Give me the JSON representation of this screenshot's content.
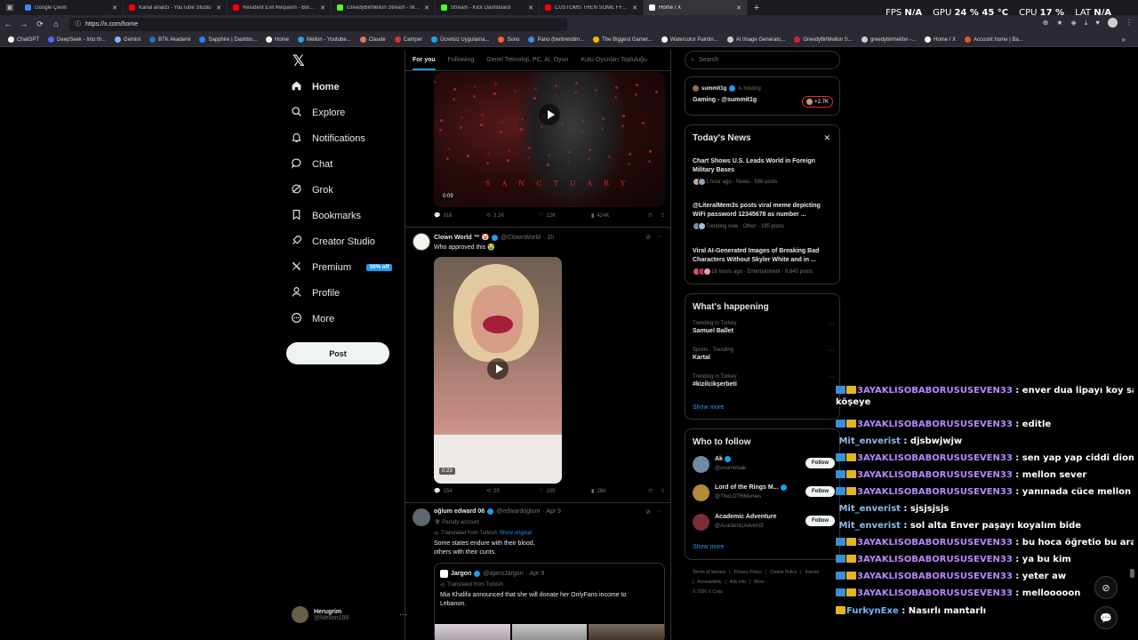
{
  "browser": {
    "tabs": [
      {
        "label": "Google Çeviri",
        "color": "#4285f4"
      },
      {
        "label": "Kanal analizi - YouTube Studio",
        "color": "#ff0000"
      },
      {
        "label": "Resident Evil Requiem - Bölüm 5",
        "color": "#ff0000"
      },
      {
        "label": "GreedyBirMellon Stream - Watch",
        "color": "#53fc18"
      },
      {
        "label": "Stream - Kick Dashboard",
        "color": "#53fc18"
      },
      {
        "label": "CUSTOMS THEN SOME FFAS AFTER",
        "color": "#ff0000"
      },
      {
        "label": "Home / X",
        "color": "#ffffff"
      }
    ],
    "new_tab": "+",
    "url": "https://x.com/home",
    "hud": {
      "fps_label": "FPS",
      "fps_value": "N/A",
      "gpu_label": "GPU",
      "gpu_value": "24 %  45 °C",
      "cpu_label": "CPU",
      "cpu_value": "17 %",
      "lat_label": "LAT",
      "lat_value": "N/A"
    },
    "bookmarks": [
      {
        "label": "ChatGPT",
        "color": "#ffffff"
      },
      {
        "label": "DeepSeek - Into th...",
        "color": "#4d6bfe"
      },
      {
        "label": "Gemini",
        "color": "#8ab4f8"
      },
      {
        "label": "BTK Akademi",
        "color": "#1f6fd1"
      },
      {
        "label": "Sapphire | Dashbo...",
        "color": "#2d7ff9"
      },
      {
        "label": "Home",
        "color": "#ffffff"
      },
      {
        "label": "Mellon - Youtube...",
        "color": "#2d9cdb"
      },
      {
        "label": "Claude",
        "color": "#d97757"
      },
      {
        "label": "Camper",
        "color": "#e0312a"
      },
      {
        "label": "Ücretsiz Uygulama...",
        "color": "#1ea1f2"
      },
      {
        "label": "Suno",
        "color": "#f0643c"
      },
      {
        "label": "Pano (bentrendim...",
        "color": "#3b8beb"
      },
      {
        "label": "The Biggest Gamer...",
        "color": "#ffb400"
      },
      {
        "label": "Watercolor Paintin...",
        "color": "#ffffff"
      },
      {
        "label": "AI Image Generato...",
        "color": "#cccccc"
      },
      {
        "label": "GreedyBirMellon S...",
        "color": "#d4213a"
      },
      {
        "label": "greedybirmellon -...",
        "color": "#cccccc"
      },
      {
        "label": "Home / X",
        "color": "#ffffff"
      },
      {
        "label": "Account home | Ba...",
        "color": "#e8542f"
      }
    ]
  },
  "x_nav": {
    "items": [
      {
        "label": "Home",
        "icon": "home-icon"
      },
      {
        "label": "Explore",
        "icon": "search-icon"
      },
      {
        "label": "Notifications",
        "icon": "bell-icon"
      },
      {
        "label": "Chat",
        "icon": "chat-icon"
      },
      {
        "label": "Grok",
        "icon": "grok-icon"
      },
      {
        "label": "Bookmarks",
        "icon": "bookmark-icon"
      },
      {
        "label": "Creator Studio",
        "icon": "rocket-icon"
      },
      {
        "label": "Premium",
        "icon": "x-icon"
      },
      {
        "label": "Profile",
        "icon": "person-icon"
      },
      {
        "label": "More",
        "icon": "more-circle-icon"
      }
    ],
    "premium_badge": "50% off",
    "post_button": "Post",
    "account": {
      "name": "Herugrim",
      "handle": "@Mellon199"
    }
  },
  "timeline": {
    "tabs": [
      "For you",
      "Following",
      "Genel Teknoloji, PC, AI, Oyun",
      "Kutu Oyunları Topluluğu"
    ],
    "post1": {
      "duration": "0:09",
      "overlay_word": "SANCTUARY",
      "stats": {
        "replies": "316",
        "reposts": "3.2K",
        "likes": "12K",
        "views": "424K"
      }
    },
    "post2": {
      "name": "Clown World ™ 🤡",
      "handle": "@ClownWorld",
      "time": "· 1h",
      "text": "Who approved this 😭",
      "duration": "0:23",
      "stats": {
        "replies": "154",
        "reposts": "29",
        "likes": "105",
        "views": "26K"
      }
    },
    "post3": {
      "name": "oğlum edward 06",
      "handle": "@edwardoglum",
      "time": "· Apr 9",
      "parody": "🛡 Parody account",
      "translated": "Translated from Turkish",
      "show_original": "Show original",
      "text_line1": "Some states endure with their blood,",
      "text_line2": "others with their cunts.",
      "quote": {
        "name": "Jargon",
        "handle": "@ajansJargon",
        "time": "· Apr 9",
        "translated": "Translated from Turkish",
        "text_line1": "Mia Khalifa announced that she will donate her OnlyFans income to",
        "text_line2": "Lebanon."
      }
    }
  },
  "sidebar": {
    "search_placeholder": "Search",
    "live": {
      "host": "summit1g",
      "hosting": "is hosting",
      "title": "Gaming - @summit1g",
      "listeners": "+2.7K"
    },
    "news": {
      "title": "Today's News",
      "items": [
        {
          "title_line1": "Chart Shows U.S. Leads World in Foreign",
          "title_line2": "Military Bases",
          "meta": "1 hour ago · News · 598 posts"
        },
        {
          "title_line1": "@LiteralMem3s posts viral meme depicting",
          "title_line2": "WiFi password 12345678 as number ...",
          "meta": "Trending now · Other · 195 posts"
        },
        {
          "title_line1": "Viral AI-Generated Images of Breaking Bad",
          "title_line2": "Characters Without Skyler White and in ...",
          "meta": "16 hours ago · Entertainment · 9,845 posts"
        }
      ]
    },
    "happening": {
      "title": "What's happening",
      "trends": [
        {
          "meta": "Trending in Turkey",
          "name": "Samuel Ballet"
        },
        {
          "meta": "Sports · Trending",
          "name": "Kartal"
        },
        {
          "meta": "Trending in Turkey",
          "name": "#kizilcikşerbeti"
        }
      ],
      "show_more": "Show more"
    },
    "follow": {
      "title": "Who to follow",
      "accounts": [
        {
          "name": "Ak",
          "handle": "@unamelsak",
          "color": "#6d8aa6"
        },
        {
          "name": "Lord of the Rings M...",
          "handle": "@TheLOTRMemes",
          "color": "#b38a3a"
        },
        {
          "name": "Academic Adventure",
          "handle": "@AcademicAdvent3",
          "color": "#7a2e38"
        }
      ],
      "follow_label": "Follow",
      "show_more": "Show more"
    },
    "footer": [
      "Terms of Service",
      "|",
      "Privacy Policy",
      "|",
      "Cookie Policy",
      "|",
      "Imprint",
      "|",
      "Accessibility",
      "|",
      "Ads info",
      "|",
      "More ···",
      "© 2026 X Corp."
    ]
  },
  "chat": {
    "messages": [
      {
        "user": "3AYAKLISOBABORUSUSEVEN33",
        "text": "enver dua lipayı koy sağ alt",
        "cont": "köşeye",
        "badges": true
      },
      {
        "user": "3AYAKLISOBABORUSUSEVEN33",
        "text": "editle",
        "badges": true
      },
      {
        "user": "Mit_enverist",
        "text": "djsbwjwjw",
        "badges": false
      },
      {
        "user": "3AYAKLISOBABORUSUSEVEN33",
        "text": "sen yap yap ciddi diom",
        "badges": true
      },
      {
        "user": "3AYAKLISOBABORUSUSEVEN33",
        "text": "mellon sever",
        "badges": true
      },
      {
        "user": "3AYAKLISOBABORUSUSEVEN33",
        "text": "yanınada cüce mellon koy",
        "badges": true
      },
      {
        "user": "Mit_enverist",
        "text": "sjsjsjsjs",
        "badges": false
      },
      {
        "user": "Mit_enverist",
        "text": "sol alta Enver paşayı koyalım bide",
        "badges": false
      },
      {
        "user": "3AYAKLISOBABORUSUSEVEN33",
        "text": "bu hoca öğretio bu arada",
        "badges": true
      },
      {
        "user": "3AYAKLISOBABORUSUSEVEN33",
        "text": "ya bu kim",
        "badges": true
      },
      {
        "user": "3AYAKLISOBABORUSUSEVEN33",
        "text": "yeter aw",
        "badges": true
      },
      {
        "user": "3AYAKLISOBABORUSUSEVEN33",
        "text": "mellooooon",
        "badges": true
      },
      {
        "user": "FurkynExe",
        "text": "Nasırlı mantarlı",
        "badges": "gold"
      }
    ]
  }
}
